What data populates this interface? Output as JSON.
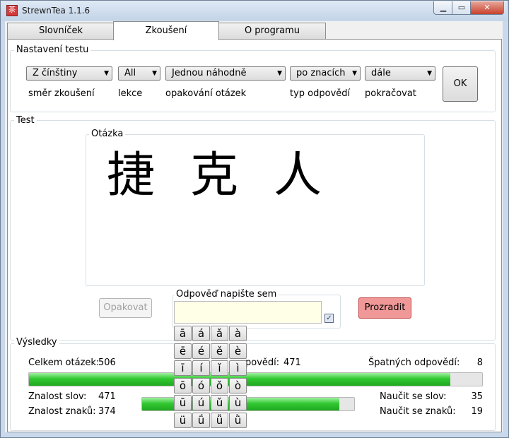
{
  "window": {
    "title": "StrewnTea 1.1.6",
    "icon": "app-seal-icon",
    "minimize_icon": "minimize-icon",
    "maximize_icon": "maximize-icon",
    "close_icon": "close-icon"
  },
  "tabs": [
    {
      "label": "Slovníček"
    },
    {
      "label": "Zkoušení",
      "active": true
    },
    {
      "label": "O programu"
    }
  ],
  "settings": {
    "title": "Nastavení testu",
    "direction": {
      "value": "Z čínštiny",
      "caption": "směr zkoušení"
    },
    "lesson": {
      "value": "All",
      "caption": "lekce"
    },
    "repeat": {
      "value": "Jednou náhodně",
      "caption": "opakování otázek"
    },
    "answer_type": {
      "value": "po znacích",
      "caption": "typ odpovědí"
    },
    "continue": {
      "value": "dále",
      "caption": "pokračovat"
    },
    "ok_label": "OK"
  },
  "test": {
    "title": "Test",
    "question_title": "Otázka",
    "characters": [
      "捷",
      "克",
      "人"
    ],
    "repeat_label": "Opakovat",
    "answer_title": "Odpověď napište sem",
    "answer_value": "",
    "checkbox_checked": true,
    "reveal_label": "Prozradit"
  },
  "diacritics": [
    [
      "ā",
      "á",
      "ǎ",
      "à"
    ],
    [
      "ē",
      "é",
      "ě",
      "è"
    ],
    [
      "ī",
      "í",
      "ǐ",
      "ì"
    ],
    [
      "ō",
      "ó",
      "ǒ",
      "ò"
    ],
    [
      "ū",
      "ú",
      "ǔ",
      "ù"
    ],
    [
      "ü",
      "ǘ",
      "ǚ",
      "ǜ"
    ]
  ],
  "results": {
    "title": "Výsledky",
    "total_label": "Celkem otázek:",
    "total_value": "506",
    "correct_label_visible": "povědí:",
    "correct_value": "471",
    "wrong_label": "Špatných odpovědí:",
    "wrong_value": "8",
    "progress_fraction": 0.93,
    "word_knowledge_label": "Znalost slov:",
    "word_knowledge_value": "471",
    "char_knowledge_label": "Znalost znaků:",
    "char_knowledge_value": "374",
    "knowledge_fraction": 0.93,
    "learn_words_label": "Naučit se slov:",
    "learn_words_value": "35",
    "learn_chars_label": "Naučit se znaků:",
    "learn_chars_value": "19"
  },
  "colors": {
    "progress_green": "#32c832",
    "reveal_button": "#f09898",
    "answer_bg": "#ffffe8"
  }
}
